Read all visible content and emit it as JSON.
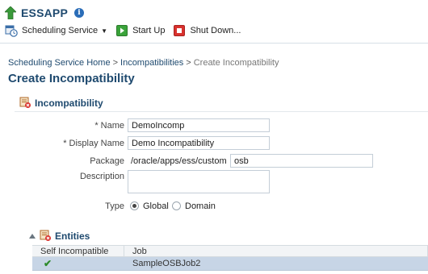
{
  "app": {
    "title": "ESSAPP",
    "info_glyph": "i"
  },
  "toolbar": {
    "scheduling_service_label": "Scheduling Service",
    "start_up_label": "Start Up",
    "shut_down_label": "Shut Down..."
  },
  "breadcrumb": {
    "items": [
      "Scheduling Service Home",
      "Incompatibilities"
    ],
    "separator": ">",
    "current": "Create Incompatibility"
  },
  "page": {
    "title": "Create Incompatibility"
  },
  "section": {
    "title": "Incompatibility"
  },
  "form": {
    "name_label": "Name",
    "name_value": "DemoIncomp",
    "display_name_label": "Display Name",
    "display_name_value": "Demo Incompatibility",
    "package_label": "Package",
    "package_prefix": "/oracle/apps/ess/custom",
    "package_value": "osb",
    "description_label": "Description",
    "description_value": "",
    "type_label": "Type",
    "type_options": [
      "Global",
      "Domain"
    ],
    "type_selected": "Global",
    "required_marker": "*"
  },
  "entities": {
    "title": "Entities",
    "columns": [
      "Self Incompatible",
      "Job"
    ],
    "rows": [
      {
        "self_incompatible": true,
        "job": "SampleOSBJob2"
      }
    ],
    "check_glyph": "✔"
  },
  "colors": {
    "brand_blue": "#1f4a6f",
    "selected_row": "#c7d5e6",
    "start_green": "#3aa33a",
    "shutdown_red": "#d9322e"
  }
}
